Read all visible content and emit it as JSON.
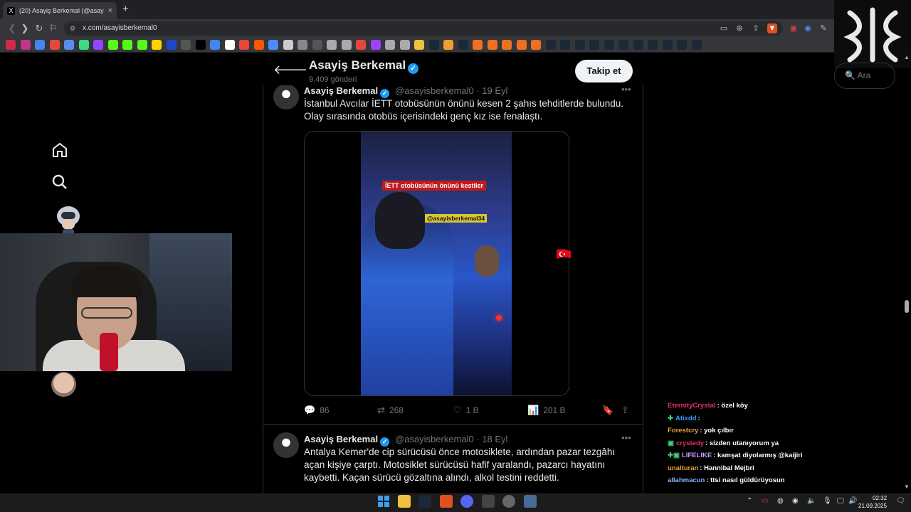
{
  "browser": {
    "tab_title": "(20) Asayiş Berkemal (@asay",
    "tab_favicon": "X",
    "url": "x.com/asayisberkemal0",
    "new_tab_icon": "+",
    "close_icon": "×"
  },
  "profile": {
    "name": "Asayiş Berkemal",
    "post_count": "9.409 gönderi",
    "follow_label": "Takip et",
    "search_placeholder": "Ara"
  },
  "tweets": [
    {
      "name": "Asayiş Berkemal",
      "handle": "@asayisberkemal0",
      "date": "· 19 Eyl",
      "text": "İstanbul Avcılar İETT otobüsünün önünü kesen 2 şahıs tehditlerde bulundu. Olay sırasında otobüs içerisindeki genç kız ise fenalaştı.",
      "video_caption": "İETT otobüsünün önünü kestiler",
      "video_handle": "@asayisberkemal34",
      "replies": "86",
      "reposts": "268",
      "likes": "1 B",
      "views": "201 B"
    },
    {
      "name": "Asayiş Berkemal",
      "handle": "@asayisberkemal0",
      "date": "· 18 Eyl",
      "text": "Antalya Kemer'de cip sürücüsü önce motosiklete, ardından pazar tezgâhı açan kişiye çarptı. Motosiklet sürücüsü hafif yaralandı, pazarcı hayatını kaybetti. Kaçan sürücü gözaltına alındı, alkol testini reddetti."
    }
  ],
  "chat": [
    {
      "user": "EternityCrystal",
      "color": "#e0306a",
      "msg": ": özel köy",
      "badge": ""
    },
    {
      "user": "Atixdd",
      "color": "#3d9cff",
      "msg": ":",
      "badge": "✚"
    },
    {
      "user": "Forestcry",
      "color": "#e8a040",
      "msg": ": yok çılbır",
      "badge": ""
    },
    {
      "user": "crystedy",
      "color": "#e0306a",
      "msg": ": sizden utanıyorum ya",
      "badge": "▣"
    },
    {
      "user": "LIFELIKE",
      "color": "#c8a0ff",
      "msg": ": kamşat diyolarmış @kaijiri",
      "badge": "✚▣"
    },
    {
      "user": "unalturan",
      "color": "#e8a040",
      "msg": ": Hannibal Mejbri",
      "badge": ""
    },
    {
      "user": "allahmacun",
      "color": "#8ab4ff",
      "msg": ": ttsi nasıl güldürüyosun",
      "badge": ""
    }
  ],
  "taskbar": {
    "time": "02:32",
    "date": "21.09.2025"
  },
  "colors": {
    "accent": "#1d9bf0",
    "background": "#000000",
    "follow_bg": "#eff3f4"
  }
}
